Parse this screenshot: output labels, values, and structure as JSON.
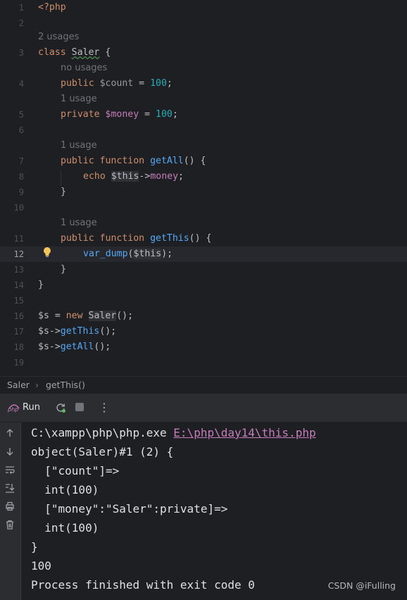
{
  "editor": {
    "lines": {
      "l1": "1",
      "l2": "2",
      "l3": "3",
      "l4": "4",
      "l5": "5",
      "l6": "6",
      "l7": "7",
      "l8": "8",
      "l9": "9",
      "l10": "10",
      "l11": "11",
      "l12": "12",
      "l13": "13",
      "l14": "14",
      "l15": "15",
      "l16": "16",
      "l17": "17",
      "l18": "18",
      "l19": "19"
    },
    "hints": {
      "class_usages": "2 usages",
      "count_usages": "no usages",
      "money_usages": "1 usage",
      "getall_usages": "1 usage",
      "getthis_usages": "1 usage"
    },
    "tokens": {
      "php_open": "<?php",
      "kw_class": "class",
      "class_name": "Saler",
      "brace_open": "{",
      "brace_close": "}",
      "kw_public": "public",
      "kw_private": "private",
      "kw_function": "function",
      "kw_echo": "echo",
      "kw_new": "new",
      "var_count": "$count",
      "var_money": "$money",
      "var_this": "$this",
      "var_s": "$s",
      "eq": " = ",
      "num_100": "100",
      "semi": ";",
      "fn_getall": "getAll",
      "fn_getthis": "getThis",
      "fn_var_dump": "var_dump",
      "parens_brace": "() {",
      "arrow": "->",
      "prop_money": "money",
      "call_end": "();"
    }
  },
  "breadcrumb": {
    "class": "Saler",
    "separator": "›",
    "method": "getThis()"
  },
  "run": {
    "label": "Run",
    "php_badge": "php",
    "more": "⋮"
  },
  "console": {
    "cmd_exe": "C:\\xampp\\php\\php.exe ",
    "cmd_file": "E:\\php\\day14\\this.php",
    "out1": "object(Saler)#1 (2) {",
    "out2": "  [\"count\"]=>",
    "out3": "  int(100)",
    "out4": "  [\"money\":\"Saler\":private]=>",
    "out5": "  int(100)",
    "out6": "}",
    "out7": "100",
    "out8": "Process finished with exit code 0"
  },
  "watermark": "CSDN @iFulling",
  "colors": {
    "background": "#1e1f22",
    "keyword": "#cf8e6d",
    "function": "#56a8f5",
    "number": "#2aacb8",
    "variable": "#c77dbb",
    "hint": "#6f737a",
    "current_line": "#26282e"
  }
}
